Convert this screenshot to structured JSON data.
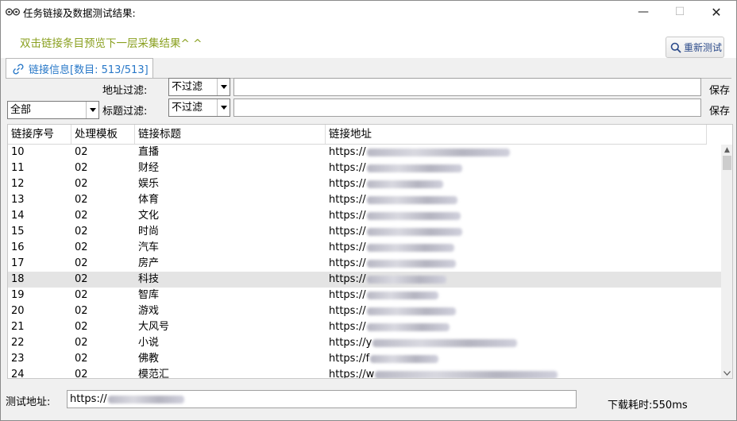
{
  "window": {
    "title": "任务链接及数据测试结果:",
    "min_glyph": "—",
    "max_glyph": "☐",
    "close_glyph": "✕"
  },
  "hint": "双击链接条目预览下一层采集结果^ ^",
  "retest_label": "重新测试",
  "tab_label": "链接信息[数目: 513/513]",
  "filters": {
    "category_value": "全部",
    "address_label": "地址过滤:",
    "address_mode": "不过滤",
    "title_label": "标题过滤:",
    "title_mode": "不过滤",
    "save_label": "保存"
  },
  "table": {
    "columns": [
      "链接序号",
      "处理模板",
      "链接标题",
      "链接地址"
    ],
    "rows": [
      {
        "no": "10",
        "tpl": "02",
        "title": "直播",
        "url": "https://"
      },
      {
        "no": "11",
        "tpl": "02",
        "title": "财经",
        "url": "https://"
      },
      {
        "no": "12",
        "tpl": "02",
        "title": "娱乐",
        "url": "https://"
      },
      {
        "no": "13",
        "tpl": "02",
        "title": "体育",
        "url": "https://"
      },
      {
        "no": "14",
        "tpl": "02",
        "title": "文化",
        "url": "https://"
      },
      {
        "no": "15",
        "tpl": "02",
        "title": "时尚",
        "url": "https://"
      },
      {
        "no": "16",
        "tpl": "02",
        "title": "汽车",
        "url": "https://"
      },
      {
        "no": "17",
        "tpl": "02",
        "title": "房产",
        "url": "https://"
      },
      {
        "no": "18",
        "tpl": "02",
        "title": "科技",
        "url": "https://"
      },
      {
        "no": "19",
        "tpl": "02",
        "title": "智库",
        "url": "https://"
      },
      {
        "no": "20",
        "tpl": "02",
        "title": "游戏",
        "url": "https://"
      },
      {
        "no": "21",
        "tpl": "02",
        "title": "大风号",
        "url": "https://"
      },
      {
        "no": "22",
        "tpl": "02",
        "title": "小说",
        "url": "https://y"
      },
      {
        "no": "23",
        "tpl": "02",
        "title": "佛教",
        "url": "https://f"
      },
      {
        "no": "24",
        "tpl": "02",
        "title": "模范汇",
        "url": "https://w"
      }
    ],
    "selected_row": "18"
  },
  "bottom": {
    "test_url_label": "测试地址:",
    "test_url_value": "https://",
    "timing": "下载耗时:550ms"
  },
  "colors": {
    "hint": "#8aa020",
    "tab_text": "#2878c8",
    "selected_row": "#e4e4e4"
  }
}
